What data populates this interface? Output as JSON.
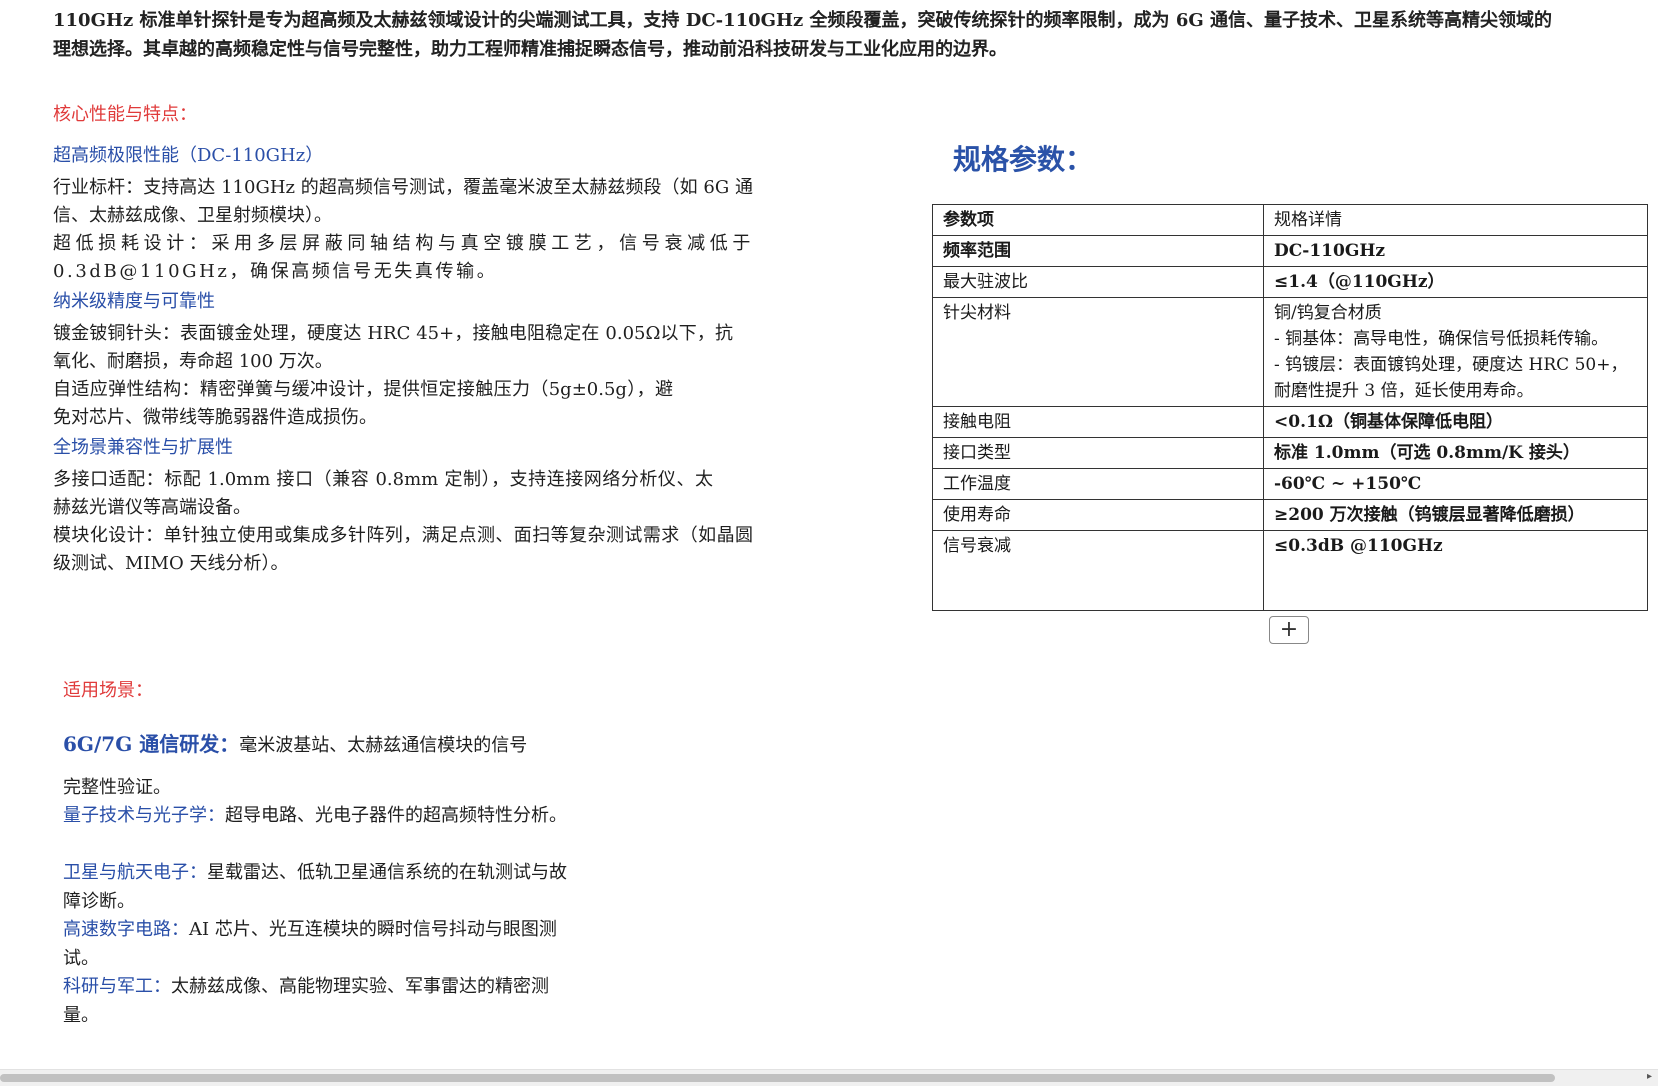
{
  "intro": "110GHz 标准单针探针是专为超高频及太赫兹领域设计的尖端测试工具，支持 DC-110GHz 全频段覆盖，突破传统探针的频率限制，成为 6G 通信、量子技术、卫星系统等高精尖领域的理想选择。其卓越的高频稳定性与信号完整性，助力工程师精准捕捉瞬态信号，推动前沿科技研发与工业化应用的边界。",
  "features_heading": "核心性能与特点：",
  "features": [
    {
      "title": "超高频极限性能（DC-110GHz）",
      "paras": [
        "行业标杆：支持高达 110GHz 的超高频信号测试，覆盖毫米波至太赫兹频段（如 6G 通信、太赫兹成像、卫星射频模块）。",
        "超低损耗设计：采用多层屏蔽同轴结构与真空镀膜工艺，信号衰减低于 0.3dB@110GHz，确保高频信号无失真传输。"
      ]
    },
    {
      "title": "纳米级精度与可靠性",
      "paras": [
        "镀金铍铜针头：表面镀金处理，硬度达 HRC 45+，接触电阻稳定在 0.05Ω以下，抗氧化、耐磨损，寿命超 100 万次。",
        "自适应弹性结构：精密弹簧与缓冲设计，提供恒定接触压力（5g±0.5g），避免对芯片、微带线等脆弱器件造成损伤。"
      ]
    },
    {
      "title": "全场景兼容性与扩展性",
      "paras": [
        "多接口适配：标配 1.0mm 接口（兼容 0.8mm 定制），支持连接网络分析仪、太赫兹光谱仪等高端设备。",
        "模块化设计：单针独立使用或集成多针阵列，满足点测、面扫等复杂测试需求（如晶圆级测试、MIMO 天线分析）。"
      ]
    }
  ],
  "spec_title": "规格参数：",
  "spec_table": {
    "header": [
      "参数项",
      "规格详情"
    ],
    "rows": [
      {
        "key": "频率范围",
        "lines": [
          "DC-110GHz"
        ]
      },
      {
        "key": "最大驻波比",
        "lines": [
          "≤1.4（@110GHz）"
        ]
      },
      {
        "key": "针尖材料",
        "lines": [
          "铜/钨复合材质",
          "- 铜基体：高导电性，确保信号低损耗传输。",
          "- 钨镀层：表面镀钨处理，硬度达 HRC 50+，耐磨性提升 3 倍，延长使用寿命。"
        ]
      },
      {
        "key": "接触电阻",
        "lines": [
          "<0.1Ω（铜基体保障低电阻）"
        ]
      },
      {
        "key": "接口类型",
        "lines": [
          "标准 1.0mm（可选 0.8mm/K 接头）"
        ]
      },
      {
        "key": "工作温度",
        "lines": [
          "-60℃ ~ +150℃"
        ]
      },
      {
        "key": "使用寿命",
        "lines": [
          "≥200 万次接触（钨镀层显著降低磨损）"
        ]
      },
      {
        "key": "信号衰减",
        "lines": [
          "≤0.3dB @110GHz"
        ]
      }
    ]
  },
  "add_button": "+",
  "scenes_heading": "适用场景：",
  "scenes": [
    {
      "label": "6G/7G 通信研发：",
      "text": "毫米波基站、太赫兹通信模块的信号",
      "text2": "完整性验证。"
    },
    {
      "label": "量子技术与光子学：",
      "text": "超导电路、光电子器件的超高频特性分析。"
    },
    {
      "label": "卫星与航天电子：",
      "text": "星载雷达、低轨卫星通信系统的在轨测试与故障诊断。"
    },
    {
      "label": "高速数字电路：",
      "text": "AI 芯片、光互连模块的瞬时信号抖动与眼图测试。"
    },
    {
      "label": "科研与军工：",
      "text": "太赫兹成像、高能物理实验、军事雷达的精密测量。"
    }
  ],
  "scroll_arrow": "▸"
}
